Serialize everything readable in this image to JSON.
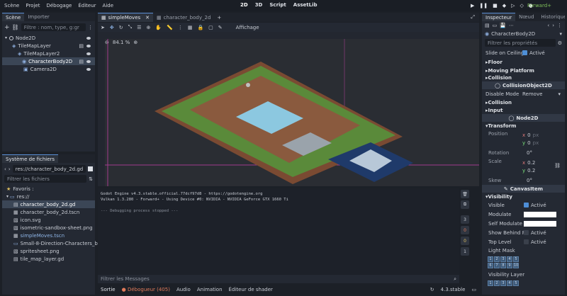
{
  "menu": {
    "items": [
      "Scène",
      "Projet",
      "Débogage",
      "Éditeur",
      "Aide"
    ]
  },
  "workspaces": {
    "items": [
      "2D",
      "3D",
      "Script",
      "AssetLib"
    ]
  },
  "renderer": "Forward+",
  "scene_dock": {
    "tabs": [
      "Scène",
      "Importer"
    ],
    "filter_placeholder": "Filtre : nom, type, g:gr",
    "tree": [
      {
        "label": "Node2D",
        "indent": 0
      },
      {
        "label": "TileMapLayer",
        "indent": 1
      },
      {
        "label": "TileMapLayer2",
        "indent": 1
      },
      {
        "label": "CharacterBody2D",
        "indent": 2,
        "selected": true
      },
      {
        "label": "Camera2D",
        "indent": 3
      }
    ]
  },
  "filesystem": {
    "title": "Système de fichiers",
    "path": "res://character_body_2d.gd",
    "filter_placeholder": "Filtrer les fichiers",
    "items": [
      {
        "label": "Favoris :",
        "indent": 0
      },
      {
        "label": "res://",
        "indent": 0
      },
      {
        "label": "character_body_2d.gd",
        "indent": 1,
        "selected": true
      },
      {
        "label": "character_body_2d.tscn",
        "indent": 1
      },
      {
        "label": "icon.svg",
        "indent": 1
      },
      {
        "label": "isometric-sandbox-sheet.png",
        "indent": 1
      },
      {
        "label": "simpleMoves.tscn",
        "indent": 1,
        "highlight": true
      },
      {
        "label": "Small-8-Direction-Characters_by_Ax...",
        "indent": 1
      },
      {
        "label": "spritesheet.png",
        "indent": 1
      },
      {
        "label": "tile_map_layer.gd",
        "indent": 1
      }
    ]
  },
  "editor_tabs": [
    {
      "label": "simpleMoves",
      "active": true
    },
    {
      "label": "character_body_2d",
      "active": false
    }
  ],
  "toolbar": {
    "view_label": "Affichage"
  },
  "viewport": {
    "zoom": "84.1 %"
  },
  "output": {
    "lines": [
      "Godot Engine v4.3.stable.official.77dcf97d8 - https://godotengine.org",
      "Vulkan 1.3.280 - Forward+ - Using Device #0: NVIDIA - NVIDIA GeForce GTX 1660 Ti",
      "",
      "--- Debugging process stopped ---"
    ],
    "filter_placeholder": "Filtrer les Messages",
    "counts": [
      "3",
      "0",
      "0",
      "1"
    ]
  },
  "bottom_tabs": [
    "Sortie",
    "Débogueur (405)",
    "Audio",
    "Animation",
    "Éditeur de shader"
  ],
  "version": "4.3.stable",
  "inspector": {
    "tabs": [
      "Inspecteur",
      "Nœud",
      "Historique"
    ],
    "node_name": "CharacterBody2D",
    "filter_placeholder": "Filtrer les propriétés",
    "slide_ceiling": {
      "label": "Slide on Ceiling",
      "value": "Activé"
    },
    "sections1": [
      "Floor",
      "Moving Platform",
      "Collision"
    ],
    "cat_collision": "CollisionObject2D",
    "disable_mode": {
      "label": "Disable Mode",
      "value": "Remove"
    },
    "sections2": [
      "Collision",
      "Input"
    ],
    "cat_node2d": "Node2D",
    "transform": "Transform",
    "position": {
      "label": "Position",
      "x": "0",
      "y": "0",
      "unit": "px"
    },
    "rotation": {
      "label": "Rotation",
      "value": "0",
      "unit": "°"
    },
    "scale": {
      "label": "Scale",
      "x": "0.2",
      "y": "0.2"
    },
    "skew": {
      "label": "Skew",
      "value": "0",
      "unit": "°"
    },
    "cat_canvas": "CanvasItem",
    "visibility": "Visibility",
    "visible": {
      "label": "Visible",
      "value": "Activé"
    },
    "modulate": "Modulate",
    "self_modulate": "Self Modulate",
    "show_behind": {
      "label": "Show Behind Pa",
      "value": "Activé"
    },
    "top_level": {
      "label": "Top Level",
      "value": "Activé"
    },
    "light_mask": "Light Mask",
    "mask_row1": [
      "1",
      "2",
      "3",
      "4",
      "5"
    ],
    "mask_row2": [
      "6",
      "7",
      "8",
      "9",
      "10"
    ],
    "visibility_layer": "Visibility Layer",
    "vis_row": [
      "1",
      "2",
      "3",
      "4",
      "5"
    ]
  },
  "colors": {
    "accent": "#4e8ed6",
    "bg": "#1c2027",
    "panel": "#242933"
  }
}
